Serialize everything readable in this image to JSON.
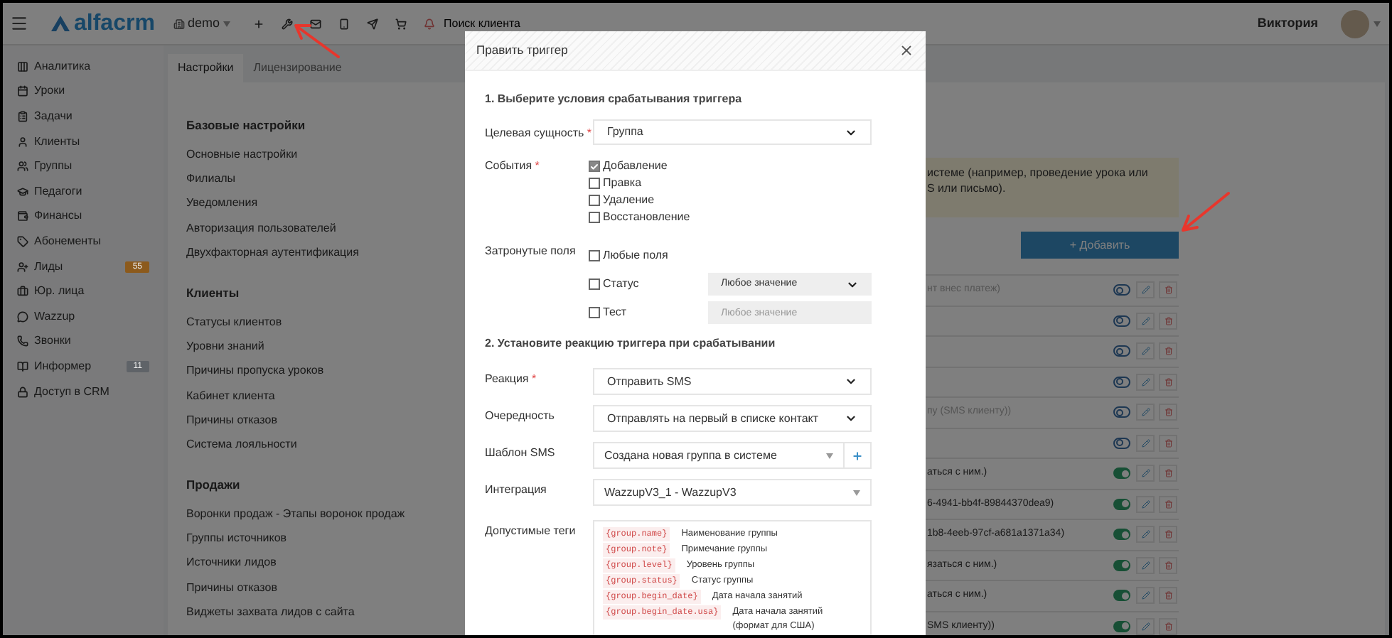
{
  "topbar": {
    "logo": "alfacrm",
    "branch": "demo",
    "search": {
      "placeholder": "Поиск клиента"
    },
    "user": "Виктория"
  },
  "sidebar": {
    "items": [
      {
        "label": "Аналитика"
      },
      {
        "label": "Уроки"
      },
      {
        "label": "Задачи"
      },
      {
        "label": "Клиенты"
      },
      {
        "label": "Группы"
      },
      {
        "label": "Педагоги"
      },
      {
        "label": "Финансы"
      },
      {
        "label": "Абонементы"
      },
      {
        "label": "Лиды",
        "badge": {
          "text": "55",
          "color": "#8c5a1c"
        }
      },
      {
        "label": "Юр. лица"
      },
      {
        "label": "Wazzup"
      },
      {
        "label": "Звонки"
      },
      {
        "label": "Информер",
        "badge": {
          "text": "11",
          "color": "#5f6368"
        }
      },
      {
        "label": "Доступ в CRM"
      }
    ]
  },
  "tabs": [
    {
      "label": "Настройки",
      "selected": true
    },
    {
      "label": "Лицензирование",
      "selected": false
    }
  ],
  "settings_sections": [
    {
      "title": "Базовые настройки",
      "links": [
        "Основные настройки",
        "Филиалы",
        "Уведомления",
        "Авторизация пользователей",
        "Двухфакторная аутентификация"
      ]
    },
    {
      "title": "Клиенты",
      "links": [
        "Статусы клиентов",
        "Уровни знаний",
        "Причины пропуска уроков",
        "Кабинет клиента",
        "Причины отказов",
        "Система лояльности"
      ]
    },
    {
      "title": "Продажи",
      "links": [
        "Воронки продаж - Этапы воронок продаж",
        "Группы источников",
        "Источники лидов",
        "Причины отказов",
        "Виджеты захвата лидов с сайта"
      ]
    }
  ],
  "notice": {
    "lines": [
      "истеме (например, проведение урока или",
      "S или письмо)."
    ]
  },
  "add_button": "+ Добавить",
  "triggers": [
    {
      "text": "нт внес платеж)",
      "on": false
    },
    {
      "on": false
    },
    {
      "on": false
    },
    {
      "on": false
    },
    {
      "text": "пу (SMS клиенту))",
      "on": false
    },
    {
      "on": false
    },
    {
      "text": "аться с ним.)",
      "on": true
    },
    {
      "text": "6-4941-bb4f-89844370dea9)",
      "on": true
    },
    {
      "text": "1b8-4eeb-97cf-a681a1371a34)",
      "on": true
    },
    {
      "text": "язаться с ним.)",
      "on": true
    },
    {
      "text": "аться с ним.)",
      "on": true
    },
    {
      "text": "SMS клиенту))",
      "on": true
    }
  ],
  "modal": {
    "title": "Править триггер",
    "section_1": "1. Выберите условия срабатывания триггера",
    "target": {
      "label": "Целевая сущность",
      "required_mark": "*",
      "value": "Группа"
    },
    "events": {
      "label": "События",
      "required_mark": "*",
      "options": [
        {
          "label": "Добавление",
          "checked": true
        },
        {
          "label": "Правка",
          "checked": false
        },
        {
          "label": "Удаление",
          "checked": false
        },
        {
          "label": "Восстановление",
          "checked": false
        }
      ]
    },
    "affected_fields": {
      "label": "Затронутые поля",
      "options": [
        {
          "kind": "plain",
          "label": "Любые поля",
          "checked": false
        },
        {
          "kind": "select",
          "label": "Статус",
          "checked": false,
          "value": "Любое значение"
        },
        {
          "kind": "input",
          "label": "Тест",
          "checked": false,
          "placeholder": "Любое значение"
        }
      ]
    },
    "section_2": "2. Установите реакцию триггера при срабатывании",
    "fields": [
      {
        "kind": "select",
        "label": "Реакция",
        "required_mark": "*",
        "value": "Отправить SMS"
      },
      {
        "kind": "select",
        "label": "Очередность",
        "value": "Отправлять на первый в списке контакт"
      },
      {
        "kind": "combo_add",
        "label": "Шаблон SMS",
        "value": "Создана новая группа в системе"
      },
      {
        "kind": "combo",
        "label": "Интеграция",
        "value": "WazzupV3_1 - WazzupV3"
      }
    ],
    "tags": {
      "label": "Допустимые теги",
      "items": [
        {
          "code": "{group.name}",
          "description": "Наименование группы"
        },
        {
          "code": "{group.note}",
          "description": "Примечание группы"
        },
        {
          "code": "{group.level}",
          "description": "Уровень группы"
        },
        {
          "code": "{group.status}",
          "description": "Статус группы"
        },
        {
          "code": "{group.begin_date}",
          "description": "Дата начала занятий"
        },
        {
          "code": "{group.begin_date.usa}",
          "description": "Дата начала занятий (формат для США)"
        }
      ]
    }
  }
}
